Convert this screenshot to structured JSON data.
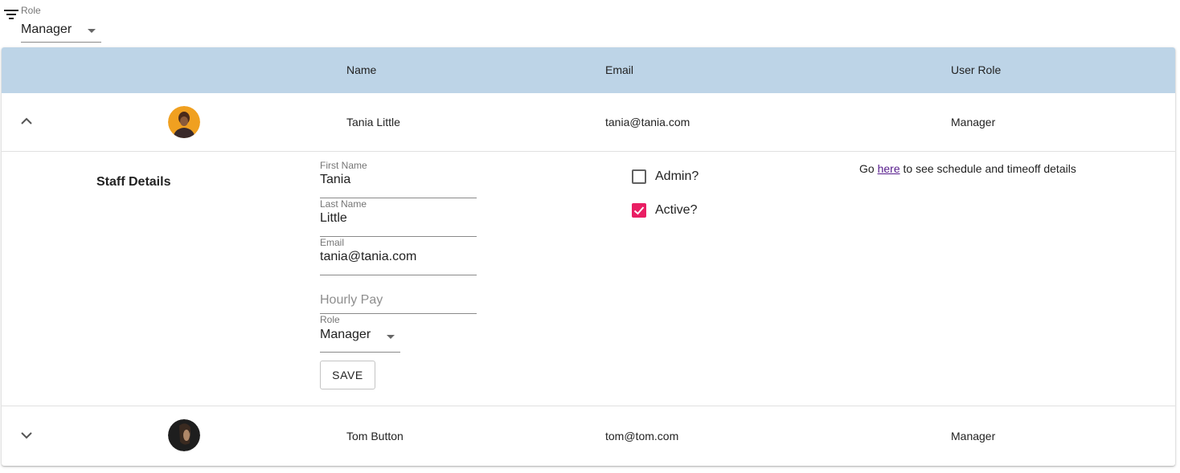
{
  "filter": {
    "label": "Role",
    "value": "Manager",
    "icon": "filter-icon"
  },
  "table": {
    "headers": [
      "Name",
      "Email",
      "User Role"
    ],
    "header_bg": "#bdd4e7"
  },
  "rows": [
    {
      "name": "Tania Little",
      "email": "tania@tania.com",
      "role": "Manager",
      "expanded": true,
      "avatar_bg": "#f0a020"
    },
    {
      "name": "Tom Button",
      "email": "tom@tom.com",
      "role": "Manager",
      "expanded": false,
      "avatar_bg": "#2a2a2a"
    }
  ],
  "details": {
    "title": "Staff Details",
    "first_name": {
      "label": "First Name",
      "value": "Tania"
    },
    "last_name": {
      "label": "Last Name",
      "value": "Little"
    },
    "email": {
      "label": "Email",
      "value": "tania@tania.com"
    },
    "hourly_pay": {
      "placeholder": "Hourly Pay",
      "value": ""
    },
    "role": {
      "label": "Role",
      "value": "Manager"
    },
    "save_label": "SAVE",
    "admin": {
      "label": "Admin?",
      "checked": false
    },
    "active": {
      "label": "Active?",
      "checked": true,
      "color": "#e91e63"
    },
    "goto_prefix": "Go",
    "goto_link": "here",
    "goto_suffix": "to see schedule and timeoff details"
  }
}
